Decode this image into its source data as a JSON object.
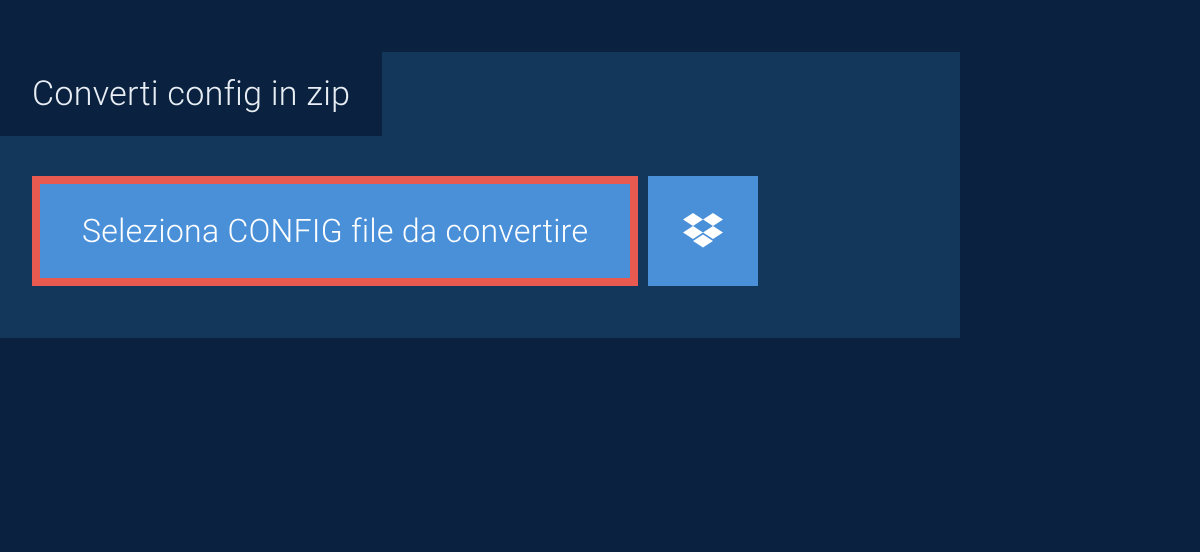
{
  "tab": {
    "title": "Converti config in zip"
  },
  "select_button": {
    "label": "Seleziona CONFIG file da convertire"
  },
  "dropbox_button": {
    "icon": "dropbox-icon"
  },
  "colors": {
    "background": "#0a2240",
    "panel": "#13375a",
    "button": "#4a90d9",
    "button_border": "#e85a4f",
    "text_light": "#e8eef4",
    "text_white": "#ffffff"
  }
}
